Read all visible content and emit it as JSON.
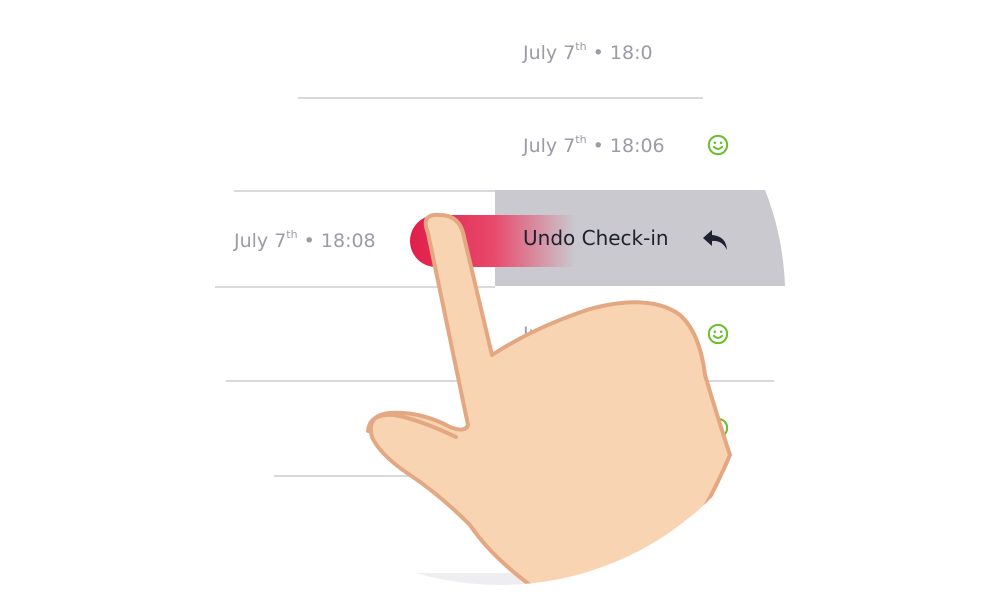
{
  "rows": [
    {
      "date": "July 7",
      "ord": "th",
      "time": "• 18:0",
      "status": "none"
    },
    {
      "date": "July 7",
      "ord": "th",
      "time": "• 18:06",
      "status": "checked-in"
    },
    {
      "date": "July 7",
      "ord": "th",
      "time": "• 18:08",
      "status": "swiping"
    },
    {
      "date": "Ju",
      "ord": "",
      "time": "",
      "status": "checked-in"
    },
    {
      "date": "",
      "ord": "",
      "time": "",
      "status": "checked-in"
    }
  ],
  "swipe_action": {
    "label": "Undo Check-in",
    "icon": "undo-arrow-icon"
  },
  "colors": {
    "accent_red": "#e01f4a",
    "smiley_green": "#6abf2e",
    "action_bg": "#c9c9cf",
    "hand_fill": "#f9d4b2",
    "hand_stroke": "#e3a882"
  },
  "icons": {
    "smiley": "smiley-face-icon",
    "undo": "undo-arrow-icon",
    "hand": "pointing-hand-icon"
  }
}
